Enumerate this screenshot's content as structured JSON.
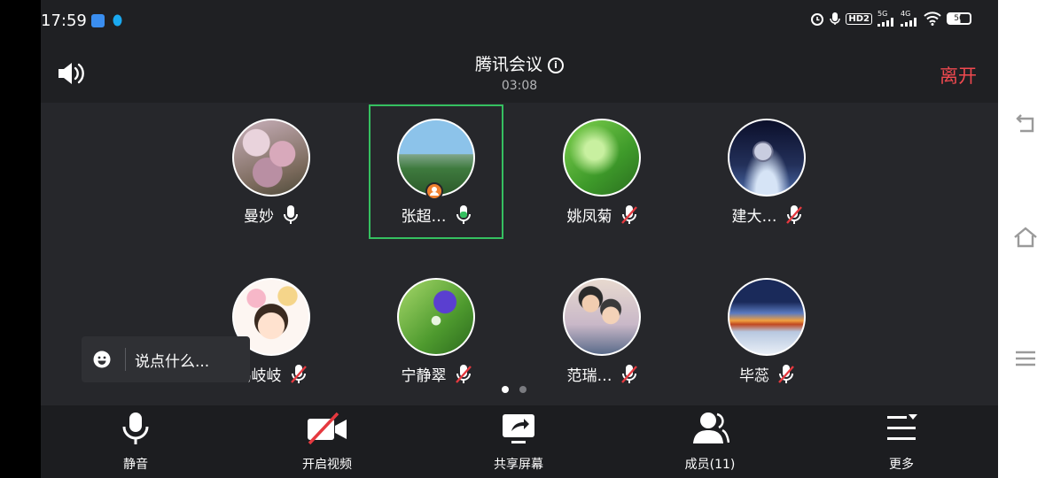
{
  "status": {
    "time": "17:59",
    "network_5g": "5G",
    "network_4g": "4G",
    "hd_label": "HD2",
    "battery": "56"
  },
  "header": {
    "title": "腾讯会议",
    "timer": "03:08",
    "leave_label": "离开"
  },
  "participants": [
    {
      "name": "曼妙",
      "mic": "on"
    },
    {
      "name": "张超…",
      "mic": "speaking",
      "host": true,
      "active": true
    },
    {
      "name": "姚凤菊",
      "mic": "muted"
    },
    {
      "name": "建大…",
      "mic": "muted"
    },
    {
      "name": "鸣岐岐",
      "mic": "muted"
    },
    {
      "name": "宁静翠",
      "mic": "muted"
    },
    {
      "name": "范瑞…",
      "mic": "muted"
    },
    {
      "name": "毕蕊",
      "mic": "muted"
    }
  ],
  "chat": {
    "placeholder": "说点什么..."
  },
  "pager": {
    "current": 1,
    "total": 2
  },
  "toolbar": {
    "mute_label": "静音",
    "video_label": "开启视频",
    "share_label": "共享屏幕",
    "members_label": "成员(11)",
    "more_label": "更多"
  },
  "colors": {
    "leave": "#f0494f",
    "active_border": "#35c060",
    "speaking_mic": "#35c060",
    "muted_slash": "#e5393f",
    "host_badge": "#f1812e",
    "video_off_slash": "#e5393f"
  }
}
